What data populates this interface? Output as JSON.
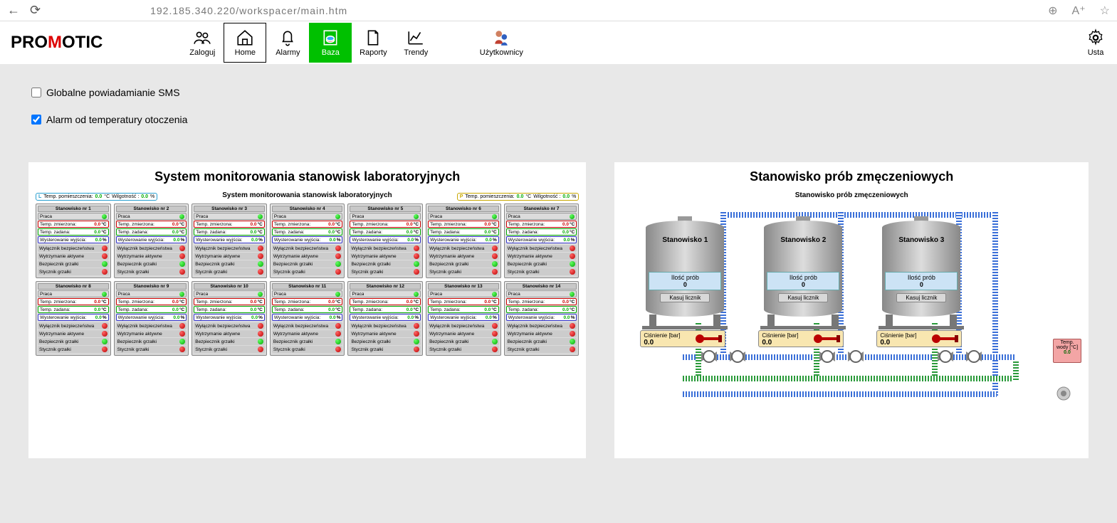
{
  "browser": {
    "url": "192.185.340.220/workspacer/main.htm"
  },
  "logo": {
    "part1": "PRO",
    "part2": "M",
    "part3": "OTIC"
  },
  "toolbar": {
    "zaloguj": "Zaloguj",
    "home": "Home",
    "alarmy": "Alarmy",
    "baza": "Baza",
    "raporty": "Raporty",
    "trendy": "Trendy",
    "uzytkownicy": "Użytkownicy",
    "usta": "Usta"
  },
  "checks": {
    "sms": "Globalne powiadamianie SMS",
    "alarm": "Alarm od temperatury otoczenia"
  },
  "left_panel": {
    "title": "System monitorowania stanowisk laboratoryjnych",
    "mini_title": "System monitorowania stanowisk laboratoryjnych",
    "env_left": {
      "key_l": "L",
      "l1": "Temp. pomieszczenia:",
      "v1": "0.0",
      "u1": "°C",
      "l2": "Wilgotność :",
      "v2": "0.0",
      "u2": "%"
    },
    "env_right": {
      "key_l": "P",
      "l1": "Temp. pomieszczenia:",
      "v1": "0.0",
      "u1": "°C",
      "l2": "Wilgotność :",
      "v2": "0.0",
      "u2": "%"
    },
    "row_labels": {
      "praca": "Praca",
      "temp_zm": "Temp. zmierzona:",
      "temp_zad": "Temp. zadana:",
      "wyster": "Wysterowanie wyjścia:",
      "s1": "Wyłącznik bezpieczeństwa",
      "s2": "Wytrzymanie aktywne",
      "s3": "Bezpiecznik grzałki",
      "s4": "Stycznik grzałki"
    },
    "val": {
      "zero_c": "0.0",
      "unit_c": "°C",
      "unit_p": "%"
    },
    "stations": [
      "Stanowisko nr 1",
      "Stanowisko nr 2",
      "Stanowisko nr 3",
      "Stanowisko nr 4",
      "Stanowisko nr 5",
      "Stanowisko nr 6",
      "Stanowisko nr 7",
      "Stanowisko nr 8",
      "Stanowisko nr 9",
      "Stanowisko nr 10",
      "Stanowisko nr 11",
      "Stanowisko nr 12",
      "Stanowisko nr 13",
      "Stanowisko nr 14"
    ]
  },
  "right_panel": {
    "title": "Stanowisko prób zmęczeniowych",
    "mini_title": "Stanowisko prób zmęczeniowych",
    "tanks": [
      {
        "name": "Stanowisko 1",
        "prob_label": "Ilość prób",
        "prob_val": "0",
        "btn": "Kasuj licznik"
      },
      {
        "name": "Stanowisko 2",
        "prob_label": "Ilość prób",
        "prob_val": "0",
        "btn": "Kasuj licznik"
      },
      {
        "name": "Stanowisko 3",
        "prob_label": "Ilość prób",
        "prob_val": "0",
        "btn": "Kasuj licznik"
      }
    ],
    "gauges": [
      {
        "label": "Ciśnienie [bar]",
        "val": "0.0"
      },
      {
        "label": "Ciśnienie [bar]",
        "val": "0.0"
      },
      {
        "label": "Ciśnienie [bar]",
        "val": "0.0"
      }
    ],
    "water": {
      "label": "Temp. wody [°C]",
      "val": "0.0"
    }
  }
}
